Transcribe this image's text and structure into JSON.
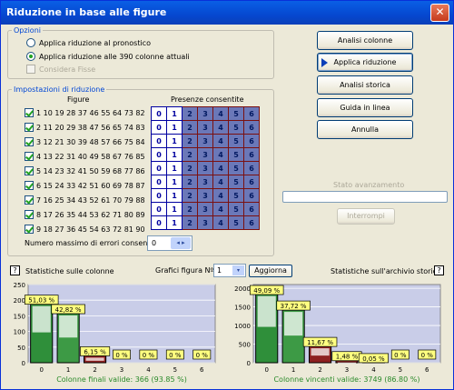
{
  "window": {
    "title": "Riduzione in base alle figure",
    "close_glyph": "✕"
  },
  "options": {
    "legend": "Opzioni",
    "radio1": "Applica riduzione al pronostico",
    "radio2": "Applica riduzione alle 390 colonne attuali",
    "check": "Considera Fisse"
  },
  "settings": {
    "legend": "Impostazioni di riduzione",
    "figures_header": "Figure",
    "presence_header": "Presenze consentite",
    "rows": [
      {
        "numbers": "1 10 19 28 37 46 55 64 73 82",
        "allowed": 2
      },
      {
        "numbers": "2 11 20 29 38 47 56 65 74 83",
        "allowed": 2
      },
      {
        "numbers": "3 12 21 30 39 48 57 66 75 84",
        "allowed": 2
      },
      {
        "numbers": "4 13 22 31 40 49 58 67 76 85",
        "allowed": 2
      },
      {
        "numbers": "5 14 23 32 41 50 59 68 77 86",
        "allowed": 2
      },
      {
        "numbers": "6 15 24 33 42 51 60 69 78 87",
        "allowed": 2
      },
      {
        "numbers": "7 16 25 34 43 52 61 70 79 88",
        "allowed": 2
      },
      {
        "numbers": "8 17 26 35 44 53 62 71 80 89",
        "allowed": 2
      },
      {
        "numbers": "9 18 27 36 45 54 63 72 81 90",
        "allowed": 2
      }
    ],
    "cells": [
      "0",
      "1",
      "2",
      "3",
      "4",
      "5",
      "6"
    ],
    "max_errors_label": "Numero massimo di errori consentiti:",
    "max_errors_value": "0",
    "spin_glyph": "◂ ▸"
  },
  "buttons": {
    "analisi_colonne": "Analisi colonne",
    "applica": "Applica riduzione",
    "analisi_storica": "Analisi storica",
    "guida": "Guida in linea",
    "annulla": "Annulla",
    "interrompi": "Interrompi"
  },
  "progress": {
    "label": "Stato avanzamento",
    "value": 0
  },
  "stats": {
    "left_title": "Statistiche sulle colonne",
    "graph_label": "Grafici figura Nº",
    "graph_value": "1",
    "aggiorna": "Aggiorna",
    "right_title": "Statistiche sull'archivio storico",
    "help": "?",
    "combo_arrow": "▾"
  },
  "chart_data": [
    {
      "type": "bar",
      "categories": [
        "0",
        "1",
        "2",
        "3",
        "4",
        "5",
        "6"
      ],
      "values": [
        51.03,
        42.82,
        6.15,
        0,
        0,
        0,
        0
      ],
      "labels": [
        "51,03 %",
        "42,82 %",
        "6,15 %",
        "0 %",
        "0 %",
        "0 %",
        "0 %"
      ],
      "counts": [
        187,
        157,
        22,
        0,
        0,
        0,
        0
      ],
      "yticks": [
        0,
        50,
        100,
        150,
        200,
        250
      ],
      "ylim": [
        0,
        250
      ],
      "caption": "Colonne finali valide: 366 (93.85 %)"
    },
    {
      "type": "bar",
      "categories": [
        "0",
        "1",
        "2",
        "3",
        "4",
        "5",
        "6"
      ],
      "values": [
        49.09,
        37.72,
        11.67,
        1.48,
        0.05,
        0,
        0
      ],
      "labels": [
        "49,09 %",
        "37,72 %",
        "11,67 %",
        "1,48 %",
        "0,05 %",
        "0 %",
        "0 %"
      ],
      "counts": [
        1840,
        1414,
        437,
        55,
        2,
        0,
        0
      ],
      "yticks": [
        0,
        500,
        1000,
        1500,
        2000
      ],
      "ylim": [
        0,
        2100
      ],
      "caption": "Colonne vincenti valide: 3749 (86.80 %)"
    }
  ]
}
